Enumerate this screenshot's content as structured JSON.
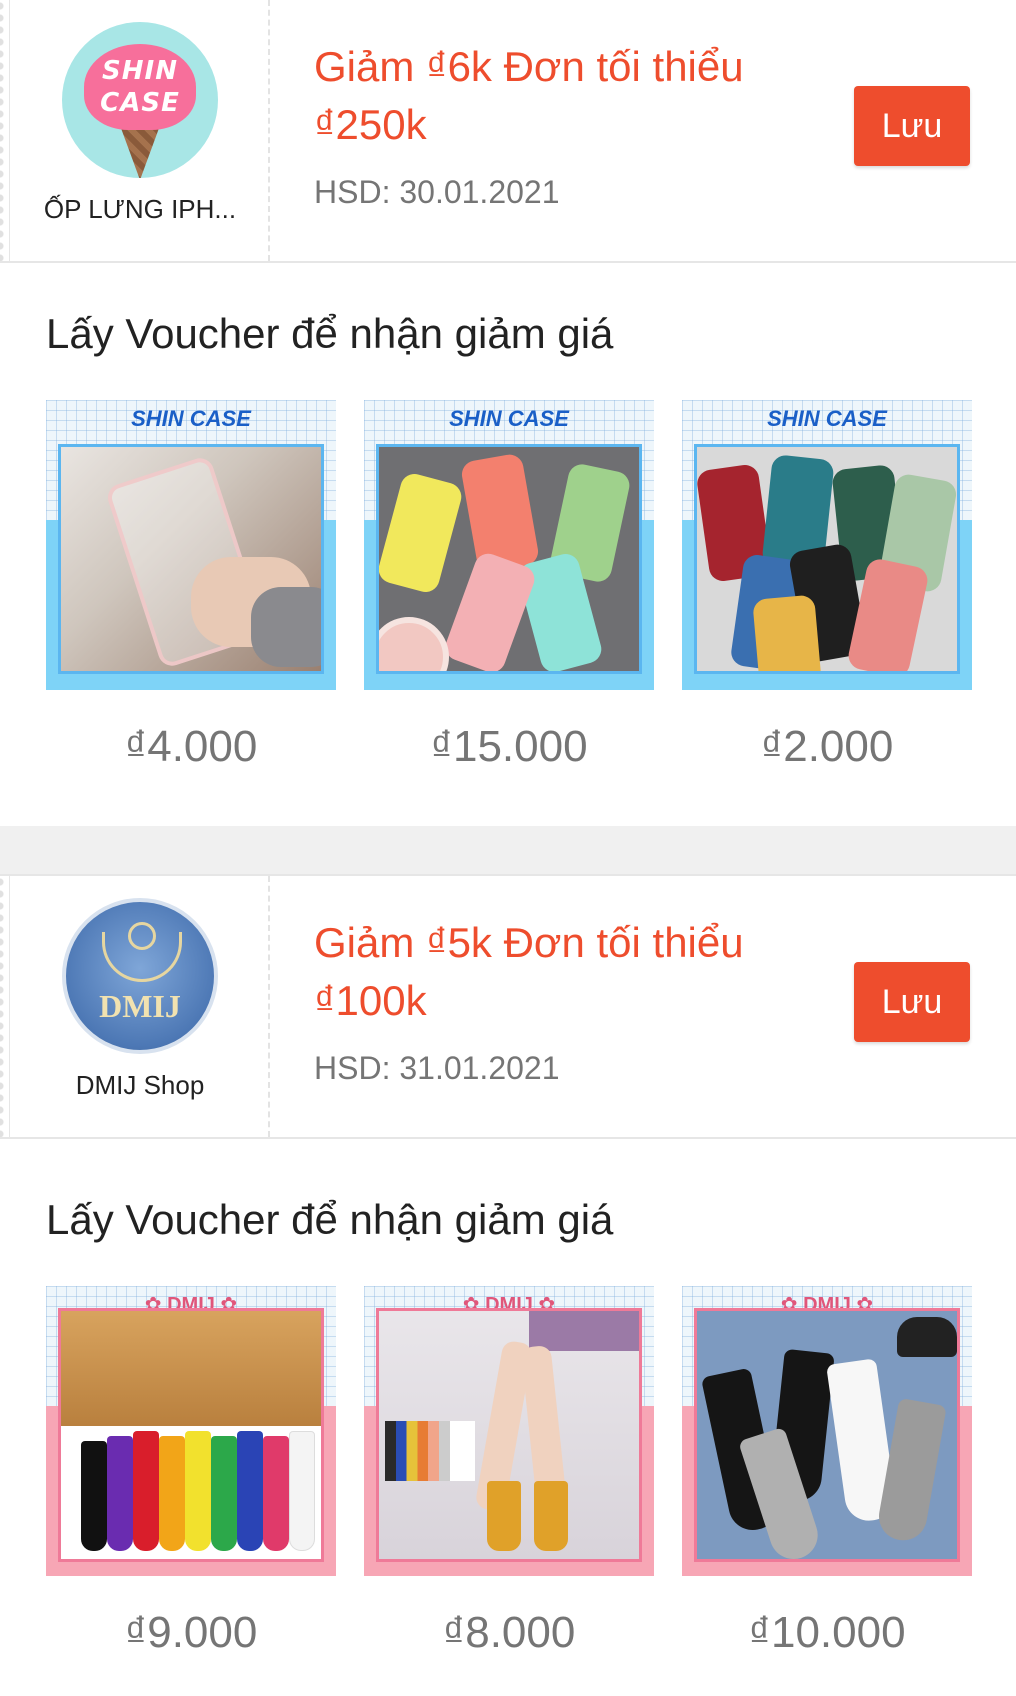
{
  "vouchers": [
    {
      "logo_text_line1": "SHIN",
      "logo_text_line2": "CASE",
      "shop_name": "ỐP LƯNG IPH...",
      "title_line1": "Giảm ₫6k Đơn tối thiểu",
      "title_line2": "₫250k",
      "expiry": "HSD: 30.01.2021",
      "save_label": "Lưu",
      "promo_heading": "Lấy Voucher để nhận giảm giá",
      "products": [
        {
          "brand": "SHIN CASE",
          "price": "₫4.000"
        },
        {
          "brand": "SHIN CASE",
          "price": "₫15.000"
        },
        {
          "brand": "SHIN CASE",
          "price": "₫2.000"
        }
      ]
    },
    {
      "logo_text": "DMIJ",
      "shop_name": "DMIJ Shop",
      "title_line1": "Giảm ₫5k Đơn tối thiểu",
      "title_line2": "₫100k",
      "expiry": "HSD: 31.01.2021",
      "save_label": "Lưu",
      "promo_heading": "Lấy Voucher để nhận giảm giá",
      "products": [
        {
          "brand": "✿ DMIJ ✿",
          "price": "₫9.000"
        },
        {
          "brand": "✿ DMIJ ✿",
          "price": "₫8.000"
        },
        {
          "brand": "✿ DMIJ ✿",
          "price": "₫10.000"
        }
      ]
    }
  ],
  "colors": {
    "accent": "#ee4d2d",
    "muted_text": "#757575",
    "separator": "#f0f0f0"
  }
}
